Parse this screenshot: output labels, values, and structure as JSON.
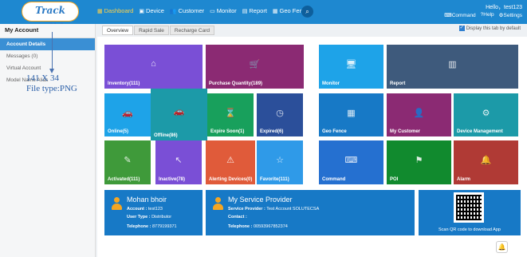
{
  "header": {
    "logo_text": "Track solid",
    "nav": [
      {
        "label": "Dashboard",
        "icon": "▦",
        "active": true
      },
      {
        "label": "Device",
        "icon": "▣"
      },
      {
        "label": "Customer",
        "icon": "👥"
      },
      {
        "label": "Monitor",
        "icon": "▭"
      },
      {
        "label": "Report",
        "icon": "▤"
      },
      {
        "label": "Geo Fence",
        "icon": "▦"
      }
    ],
    "search_icon": "⌕",
    "greeting": "Hello，test123",
    "actions": [
      {
        "label": "Command",
        "icon": "⌨"
      },
      {
        "label": "Help",
        "icon": "?"
      },
      {
        "label": "Settings",
        "icon": "⚙"
      }
    ]
  },
  "sidebar": {
    "title": "My Account",
    "items": [
      {
        "label": "Account Details",
        "active": true
      },
      {
        "label": "Messages (0)"
      },
      {
        "label": "Virtual Account"
      },
      {
        "label": "Model Name Alias"
      }
    ]
  },
  "overlay_annotation": {
    "line1": "141 X 34",
    "line2": "File type:PNG"
  },
  "tabs": [
    "Overview",
    "Rapid Sale",
    "Recharge Card"
  ],
  "display_tab_label": "Display this tab by default",
  "tiles": {
    "inventory": {
      "label": "Inventory(111)",
      "icon": "⌂"
    },
    "purchase": {
      "label": "Purchase Quantity(189)",
      "icon": "🛒"
    },
    "monitor": {
      "label": "Monitor",
      "icon": "🖥"
    },
    "report": {
      "label": "Report",
      "icon": "▥"
    },
    "online": {
      "label": "Online(5)",
      "icon": "🚗"
    },
    "offline": {
      "label": "Offline(86)",
      "icon": "🚗"
    },
    "expire": {
      "label": "Expire Soon(1)",
      "icon": "⌛"
    },
    "expired": {
      "label": "Expired(6)",
      "icon": "◷"
    },
    "geofence": {
      "label": "Geo Fence",
      "icon": "▦"
    },
    "mycustomer": {
      "label": "My Customer",
      "icon": "👤"
    },
    "devmgmt": {
      "label": "Device Management",
      "icon": "⚙"
    },
    "activated": {
      "label": "Activated(111)",
      "icon": "✎"
    },
    "inactive": {
      "label": "Inactive(78)",
      "icon": "↖"
    },
    "alerting": {
      "label": "Alerting Devices(0)",
      "icon": "⚠"
    },
    "favorite": {
      "label": "Favorite(111)",
      "icon": "☆"
    },
    "command": {
      "label": "Command",
      "icon": "⌨"
    },
    "poi": {
      "label": "POI",
      "icon": "⚑"
    },
    "alarm": {
      "label": "Alarm",
      "icon": "🔔"
    }
  },
  "account_card": {
    "name": "Mohan bhoir",
    "account_label": "Account :",
    "account_value": "test123",
    "usertype_label": "User Type :",
    "usertype_value": "Distributor",
    "telephone_label": "Telephone :",
    "telephone_value": "8779199371"
  },
  "provider_card": {
    "title": "My Service Provider",
    "provider_label": "Service Provider :",
    "provider_value": "Test Account SOLUTECSA",
    "contact_label": "Contact :",
    "contact_value": "",
    "telephone_label": "Telephone :",
    "telephone_value": "00593967852374"
  },
  "qr_card": {
    "caption": "Scan QR code to download App"
  },
  "bell_icon": "🔔",
  "colors": {
    "header_bg": "#1e88d0",
    "active_nav": "#ffd24a",
    "card_blue": "#1779c6"
  }
}
